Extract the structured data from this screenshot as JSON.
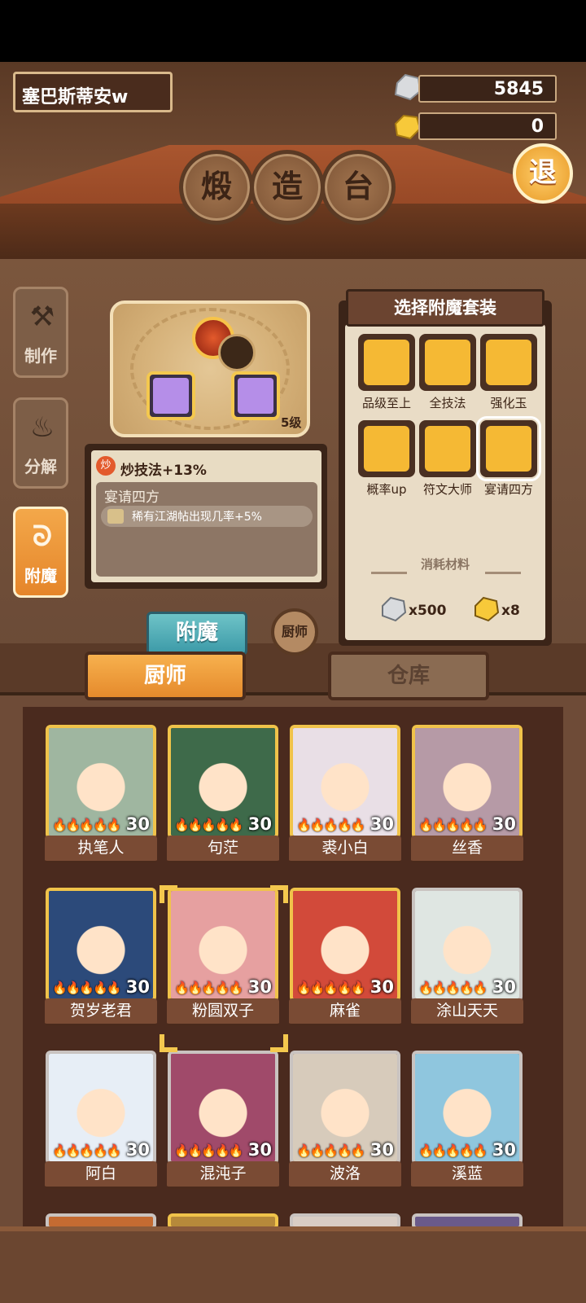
{
  "player": {
    "name": "塞巴斯蒂安w"
  },
  "resources": {
    "silver": "5845",
    "gold": "0"
  },
  "exit_label": "退",
  "title_chars": [
    "煅",
    "造",
    "台"
  ],
  "side_tabs": [
    {
      "label": "制作",
      "icon": "cooking-tool-icon"
    },
    {
      "label": "分解",
      "icon": "flame-icon"
    },
    {
      "label": "附魔",
      "icon": "swirl-flame-icon"
    }
  ],
  "enchant": {
    "level": "5级",
    "effect_badge": "炒",
    "effect": "炒技法+13%",
    "set_name": "宴请四方",
    "set_bonus": "稀有江湖帖出现几率+5%",
    "button": "附魔",
    "chef_button": "厨师"
  },
  "set_panel": {
    "title": "选择附魔套装",
    "sets": [
      {
        "label": "品级至上",
        "color": "#f5b934"
      },
      {
        "label": "全技法",
        "color": "#f5b934"
      },
      {
        "label": "强化玉",
        "color": "#f5b934"
      },
      {
        "label": "概率up",
        "color": "#f5b934"
      },
      {
        "label": "符文大师",
        "color": "#f5b934"
      },
      {
        "label": "宴请四方",
        "color": "#f5b934"
      }
    ],
    "cost_label": "消耗材料",
    "cost_silver": "x500",
    "cost_gold": "x8"
  },
  "bottom_tabs": {
    "chef": "厨师",
    "storage": "仓库"
  },
  "chefs": [
    {
      "name": "执笔人",
      "level": "30",
      "frame": "gold",
      "color": "#9fb6a0"
    },
    {
      "name": "句茫",
      "level": "30",
      "frame": "gold",
      "color": "#3e6a4a"
    },
    {
      "name": "裘小白",
      "level": "30",
      "frame": "gold",
      "color": "#e9dfe6"
    },
    {
      "name": "丝香",
      "level": "30",
      "frame": "gold",
      "color": "#b69aa6"
    },
    {
      "name": "贺岁老君",
      "level": "30",
      "frame": "gold",
      "color": "#2c4a7a"
    },
    {
      "name": "粉圆双子",
      "level": "30",
      "frame": "gold",
      "color": "#e6a0a0"
    },
    {
      "name": "麻雀",
      "level": "30",
      "frame": "gold",
      "color": "#d24a3a"
    },
    {
      "name": "涂山天天",
      "level": "30",
      "frame": "silver",
      "color": "#dfe6e2"
    },
    {
      "name": "阿白",
      "level": "30",
      "frame": "silver",
      "color": "#e7eef6"
    },
    {
      "name": "混沌子",
      "level": "30",
      "frame": "silver",
      "color": "#a04a6a"
    },
    {
      "name": "波洛",
      "level": "30",
      "frame": "silver",
      "color": "#d7cbbb"
    },
    {
      "name": "溪蓝",
      "level": "30",
      "frame": "silver",
      "color": "#8fc6de"
    }
  ]
}
